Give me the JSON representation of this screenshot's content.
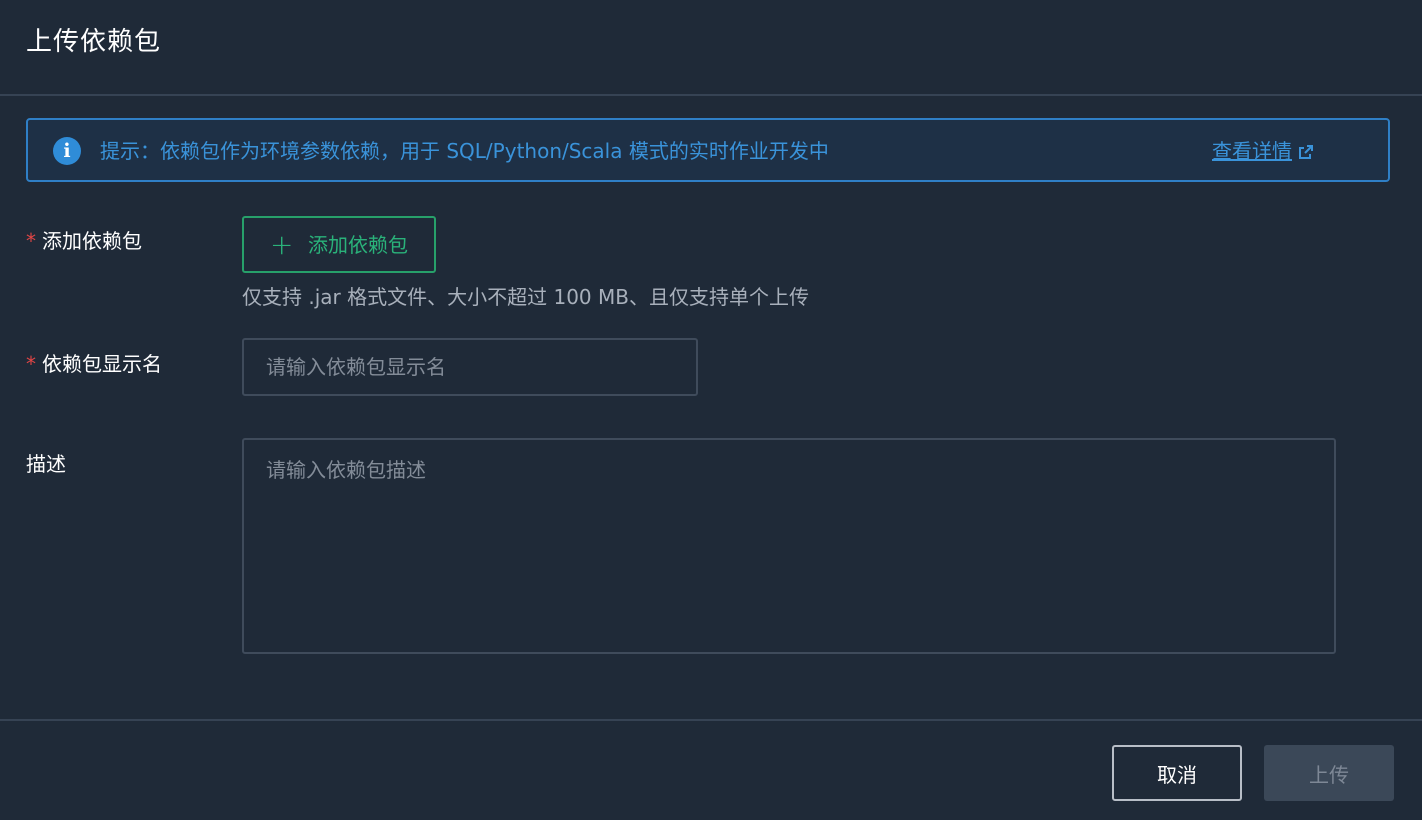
{
  "dialog": {
    "title": "上传依赖包"
  },
  "notice": {
    "icon": "info-icon",
    "text": "提示：依赖包作为环境参数依赖，用于 SQL/Python/Scala 模式的实时作业开发中",
    "link_label": "查看详情",
    "link_icon": "external-link-icon"
  },
  "form": {
    "required_mark": "*",
    "package": {
      "label": "添加依赖包",
      "button_label": "添加依赖包",
      "button_icon": "plus-icon",
      "hint": "仅支持 .jar 格式文件、大小不超过 100 MB、且仅支持单个上传"
    },
    "display_name": {
      "label": "依赖包显示名",
      "value": "",
      "placeholder": "请输入依赖包显示名"
    },
    "description": {
      "label": "描述",
      "value": "",
      "placeholder": "请输入依赖包描述"
    }
  },
  "footer": {
    "cancel_label": "取消",
    "upload_label": "上传"
  },
  "colors": {
    "background": "#1f2a38",
    "accent_blue": "#3a93da",
    "accent_green": "#2ab27a",
    "required_red": "#e04545",
    "disabled_button": "#3b4858"
  }
}
